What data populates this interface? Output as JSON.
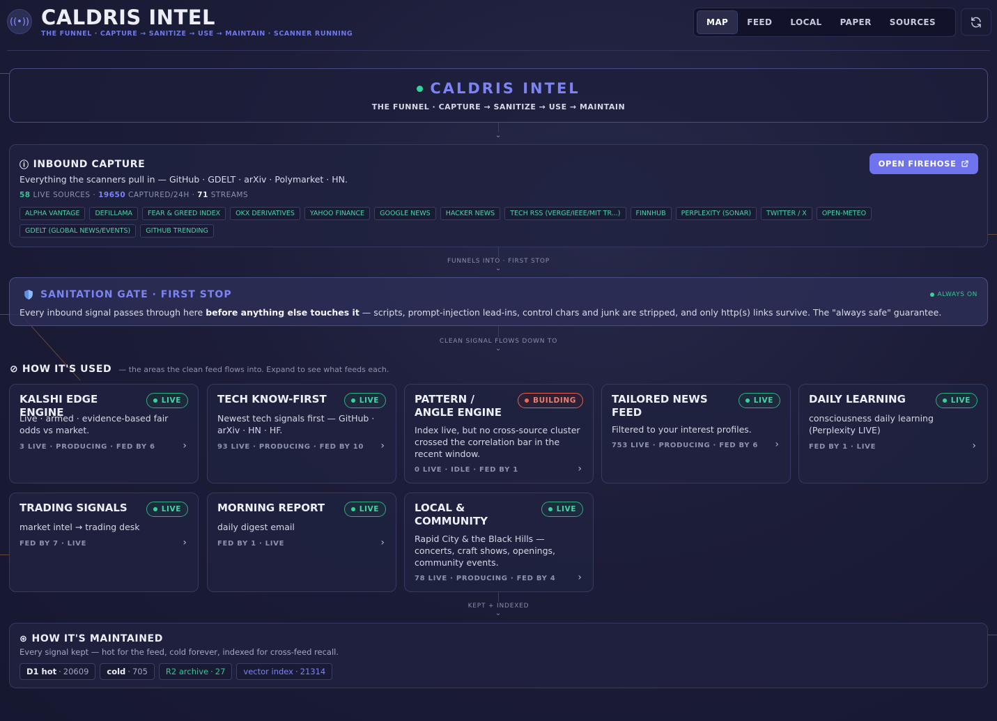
{
  "app": {
    "title": "CALDRIS INTEL",
    "subtitle": "THE FUNNEL · CAPTURE → SANITIZE → USE → MAINTAIN · SCANNER RUNNING",
    "logo_icon": "broadcast-icon"
  },
  "nav": {
    "tabs": [
      {
        "label": "MAP",
        "active": true
      },
      {
        "label": "FEED",
        "active": false
      },
      {
        "label": "LOCAL",
        "active": false
      },
      {
        "label": "PAPER",
        "active": false
      },
      {
        "label": "SOURCES",
        "active": false
      }
    ],
    "refresh_icon": "refresh-icon"
  },
  "hero": {
    "title": "CALDRIS INTEL",
    "subtitle": "THE FUNNEL · CAPTURE → SANITIZE → USE → MAINTAIN"
  },
  "inbound": {
    "title": "INBOUND CAPTURE",
    "description": "Everything the scanners pull in — GitHub · GDELT · arXiv · Polymarket · HN.",
    "live_sources_count": "58",
    "live_sources_label": "LIVE SOURCES ·",
    "captured_count": "19650",
    "captured_label": "CAPTURED/24H ·",
    "streams_count": "71",
    "streams_label": "STREAMS",
    "button_label": "OPEN FIREHOSE",
    "sources": [
      "ALPHA VANTAGE",
      "DEFILLAMA",
      "FEAR & GREED INDEX",
      "OKX DERIVATIVES",
      "YAHOO FINANCE",
      "GOOGLE NEWS",
      "HACKER NEWS",
      "TECH RSS (VERGE/IEEE/MIT TR...)",
      "FINNHUB",
      "PERPLEXITY (SONAR)",
      "TWITTER / X",
      "OPEN-METEO",
      "GDELT (GLOBAL NEWS/EVENTS)",
      "GITHUB TRENDING"
    ]
  },
  "connectors": {
    "first": "FUNNELS INTO · FIRST STOP",
    "second": "CLEAN SIGNAL FLOWS DOWN TO",
    "third": "KEPT + INDEXED"
  },
  "sanitation": {
    "title": "SANITATION GATE · FIRST STOP",
    "status": "ALWAYS ON",
    "desc_pre": "Every inbound signal passes through here ",
    "desc_bold": "before anything else touches it",
    "desc_post": " — scripts, prompt-injection lead-ins, control chars and junk are stripped, and only http(s) links survive. The \"always safe\" guarantee."
  },
  "used": {
    "title": "HOW IT'S USED",
    "subtitle": "— the areas the clean feed flows into. Expand to see what feeds each.",
    "areas": [
      {
        "title": "KALSHI EDGE ENGINE",
        "status": "LIVE",
        "desc": "Live · armed · evidence-based fair odds vs market.",
        "meta": "3 LIVE · PRODUCING · FED BY 6"
      },
      {
        "title": "TECH KNOW-FIRST",
        "status": "LIVE",
        "desc": "Newest tech signals first — GitHub · arXiv · HN · HF.",
        "meta": "93 LIVE · PRODUCING · FED BY 10"
      },
      {
        "title": "PATTERN / ANGLE ENGINE",
        "status": "BUILDING",
        "desc": "Index live, but no cross-source cluster crossed the correlation bar in the recent window.",
        "meta": "0 LIVE · IDLE · FED BY 1"
      },
      {
        "title": "TAILORED NEWS FEED",
        "status": "LIVE",
        "desc": "Filtered to your interest profiles.",
        "meta": "753 LIVE · PRODUCING · FED BY 6"
      },
      {
        "title": "DAILY LEARNING",
        "status": "LIVE",
        "desc": "consciousness daily learning (Perplexity LIVE)",
        "meta": "FED BY 1 · LIVE"
      },
      {
        "title": "TRADING SIGNALS",
        "status": "LIVE",
        "desc": "market intel → trading desk",
        "meta": "FED BY 7 · LIVE"
      },
      {
        "title": "MORNING REPORT",
        "status": "LIVE",
        "desc": "daily digest email",
        "meta": "FED BY 1 · LIVE"
      },
      {
        "title": "LOCAL & COMMUNITY",
        "status": "LIVE",
        "desc": "Rapid City & the Black Hills — concerts, craft shows, openings, community events.",
        "meta": "78 LIVE · PRODUCING · FED BY 4"
      }
    ]
  },
  "maintained": {
    "title": "HOW IT'S MAINTAINED",
    "description": "Every signal kept — hot for the feed, cold forever, indexed for cross-feed recall.",
    "chips": [
      {
        "key": "D1 hot",
        "value": "20609"
      },
      {
        "key": "cold",
        "value": "705"
      },
      {
        "key": "R2 archive",
        "value": "27"
      },
      {
        "key": "vector index",
        "value": "21314"
      }
    ]
  },
  "colors": {
    "accent": "#7b83f5",
    "live": "#3fd7a0",
    "building": "#ef7d6a",
    "button": "#6f74ee"
  }
}
